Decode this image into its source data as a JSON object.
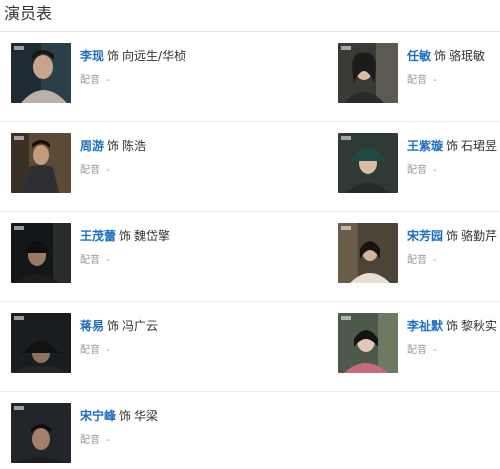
{
  "section_title": "演员表",
  "connector": "饰",
  "dub_label": "配音",
  "cast": [
    {
      "actor": "李现",
      "role": "向远生/华桢",
      "dub": "-"
    },
    {
      "actor": "任敏",
      "role": "骆珉敏",
      "dub": "-"
    },
    {
      "actor": "周游",
      "role": "陈浩",
      "dub": "-"
    },
    {
      "actor": "王紫璇",
      "role": "石珺昱",
      "dub": "-"
    },
    {
      "actor": "王茂蕾",
      "role": "魏岱擎",
      "dub": "-"
    },
    {
      "actor": "宋芳园",
      "role": "骆勤芹",
      "dub": "-"
    },
    {
      "actor": "蒋易",
      "role": "冯广云",
      "dub": "-"
    },
    {
      "actor": "李祉默",
      "role": "黎秋实",
      "dub": "-"
    },
    {
      "actor": "宋宁峰",
      "role": "华梁",
      "dub": "-"
    }
  ],
  "colors": {
    "actor_link": "#1e6fc2",
    "text": "#333333",
    "muted": "#999999",
    "divider": "#ededed"
  }
}
